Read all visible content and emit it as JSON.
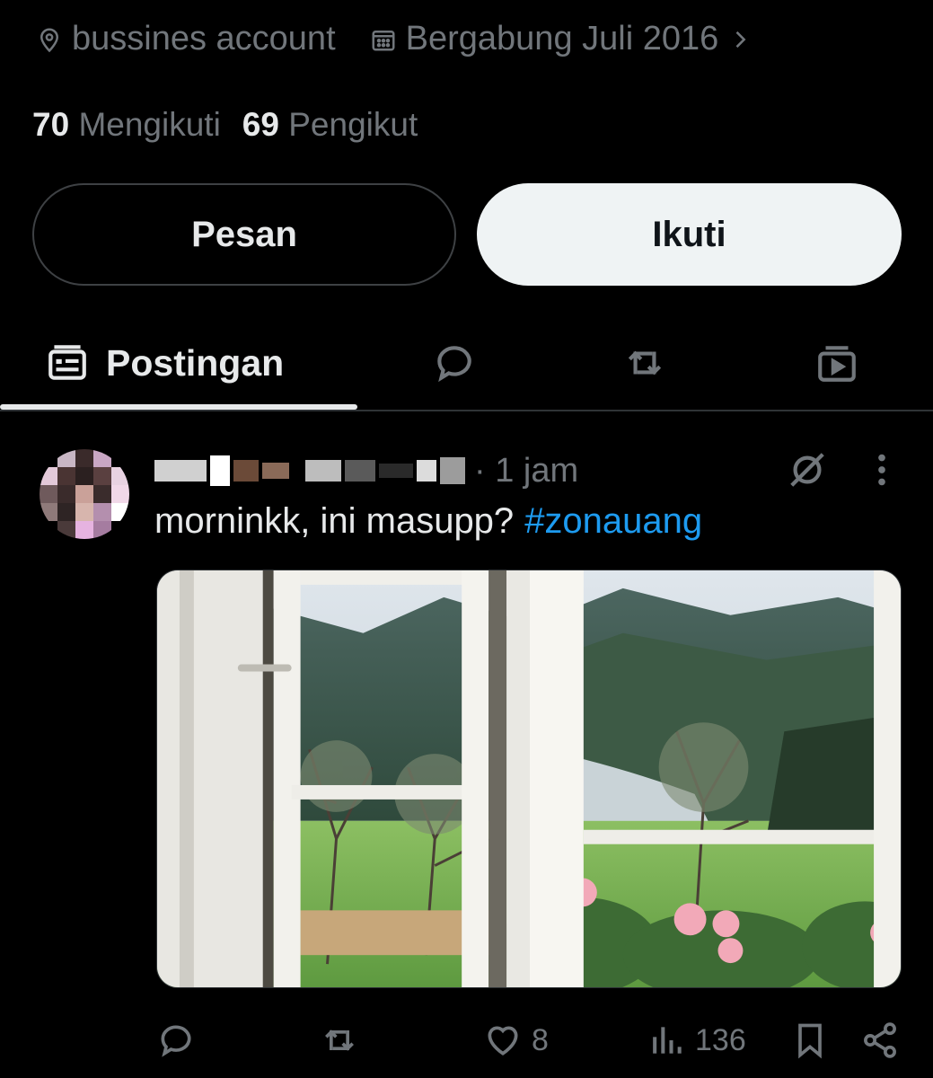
{
  "profile": {
    "location": "bussines account",
    "joined": "Bergabung Juli 2016",
    "following_count": "70",
    "following_label": "Mengikuti",
    "followers_count": "69",
    "followers_label": "Pengikut"
  },
  "buttons": {
    "message": "Pesan",
    "follow": "Ikuti"
  },
  "tabs": [
    {
      "label": "Postingan",
      "icon": "posts-icon",
      "active": true
    },
    {
      "label": "",
      "icon": "replies-icon"
    },
    {
      "label": "",
      "icon": "reposts-icon"
    },
    {
      "label": "",
      "icon": "media-icon"
    }
  ],
  "post": {
    "time": "· 1 jam",
    "text": "morninkk, ini masupp?",
    "hashtag": "#zonauang",
    "image_description_icon": "window-mountain-view-image",
    "likes": "8",
    "views": "136"
  },
  "colors": {
    "background": "#000000",
    "text": "#e7e9ea",
    "muted": "#71767b",
    "link": "#1d9bf0",
    "follow_button_bg": "#eff3f4"
  }
}
